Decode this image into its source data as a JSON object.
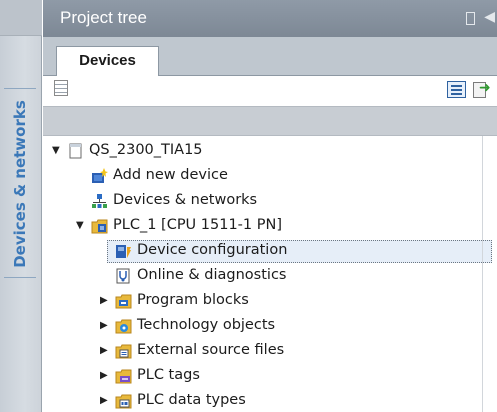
{
  "sidebar": {
    "tab_label": "Devices & networks"
  },
  "panel": {
    "title": "Project tree"
  },
  "tabs": [
    {
      "label": "Devices"
    }
  ],
  "tree": {
    "items": [
      {
        "label": "QS_2300_TIA15",
        "expander": "▼",
        "icon": "project-icon"
      },
      {
        "label": "Add new device",
        "expander": "",
        "icon": "add-device-icon"
      },
      {
        "label": "Devices & networks",
        "expander": "",
        "icon": "network-icon"
      },
      {
        "label": "PLC_1 [CPU 1511-1 PN]",
        "expander": "▼",
        "icon": "plc-folder-icon"
      },
      {
        "label": "Device configuration",
        "expander": "",
        "icon": "device-config-icon",
        "selected": true
      },
      {
        "label": "Online & diagnostics",
        "expander": "",
        "icon": "diagnostics-icon"
      },
      {
        "label": "Program blocks",
        "expander": "▶",
        "icon": "program-blocks-folder-icon"
      },
      {
        "label": "Technology objects",
        "expander": "▶",
        "icon": "technology-folder-icon"
      },
      {
        "label": "External source files",
        "expander": "▶",
        "icon": "source-files-folder-icon"
      },
      {
        "label": "PLC tags",
        "expander": "▶",
        "icon": "plc-tags-folder-icon"
      },
      {
        "label": "PLC data types",
        "expander": "▶",
        "icon": "data-types-folder-icon"
      }
    ]
  },
  "colors": {
    "sidebar_text": "#3b78b8",
    "titlebar": "#8f9aa7",
    "selection": "#e6eef8",
    "folder": "#e8b93c"
  }
}
